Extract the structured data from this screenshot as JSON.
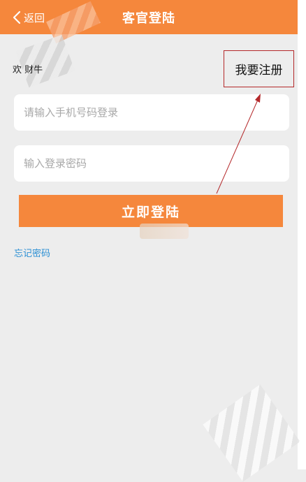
{
  "header": {
    "back_label": "返回",
    "title": "客官登陆"
  },
  "welcome": {
    "text": "欢       财牛"
  },
  "register": {
    "label": "我要注册"
  },
  "form": {
    "phone_placeholder": "请输入手机号码登录",
    "password_placeholder": "输入登录密码",
    "submit_label": "立即登陆",
    "forgot_label": "忘记密码"
  },
  "colors": {
    "brand_orange": "#f5873c",
    "link_blue": "#2a8fd4",
    "annotation_red": "#b4282a"
  },
  "icons": {
    "back": "chevron-left-icon",
    "annotation": "arrow-up-right-icon"
  }
}
